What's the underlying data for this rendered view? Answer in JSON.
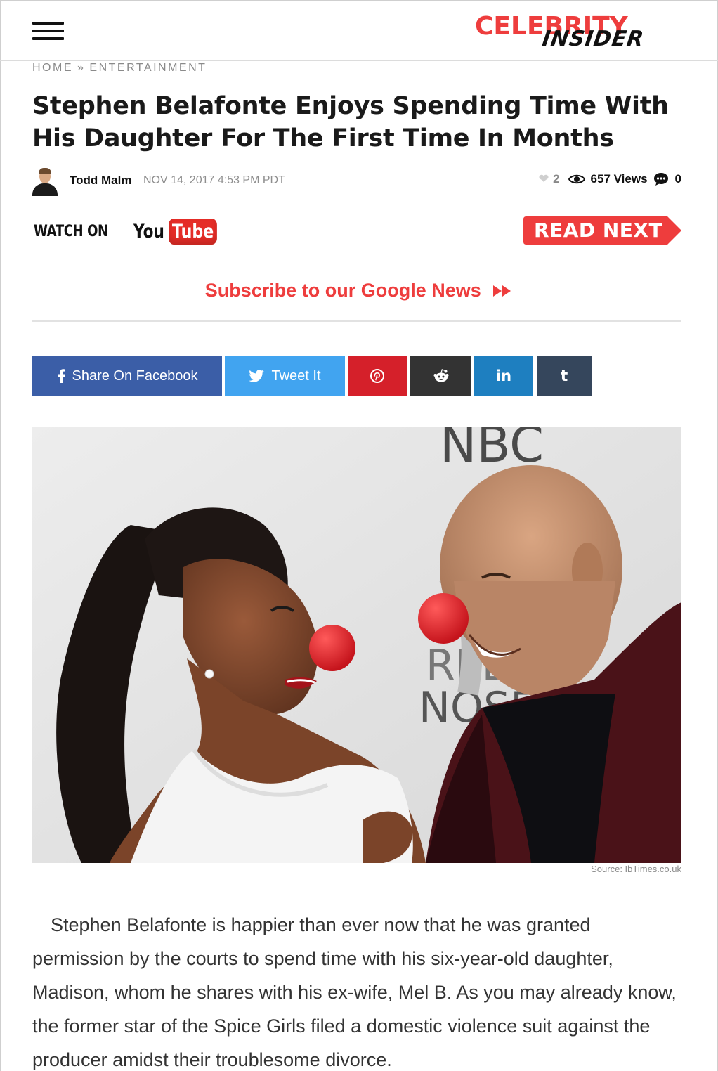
{
  "site": {
    "logo_top": "CELEBRITY",
    "logo_bottom": "INSIDER",
    "accent_color": "#ee3d3d"
  },
  "breadcrumb": {
    "home": "HOME",
    "separator": "»",
    "section": "ENTERTAINMENT"
  },
  "article": {
    "title": "Stephen Belafonte Enjoys Spending Time With His Daughter For The First Time In Months",
    "author": "Todd Malm",
    "date": "NOV 14, 2017 4:53 PM PDT",
    "likes": "2",
    "views": "657 Views",
    "comments": "0",
    "image_source": "Source: IbTimes.co.uk",
    "body": "Stephen Belafonte is happier than ever now that he was granted permission by the courts to spend time with his six-year-old daughter, Madison, whom he shares with his ex-wife, Mel B. As you may already know, the former star of the Spice Girls filed a domestic violence suit against the producer amidst their troublesome divorce."
  },
  "promo": {
    "watch_on": "WATCH ON",
    "you": "You",
    "tube": "Tube",
    "read_next": "READ NEXT",
    "subscribe": "Subscribe to our Google News"
  },
  "share": {
    "facebook_label": "Share On Facebook",
    "twitter_label": "Tweet It",
    "facebook_color": "#3b5ea7",
    "twitter_color": "#41a4f0",
    "pinterest_color": "#d5202a",
    "reddit_color": "#333333",
    "linkedin_color": "#1e7fc0",
    "tumblr_color": "#35465c",
    "linkedin_glyph": "in",
    "tumblr_glyph": "t"
  },
  "icons": {
    "menu": "hamburger-icon",
    "heart": "heart-icon",
    "eye": "eye-icon",
    "comment": "comment-icon",
    "subscribe_arrow": "fast-forward-icon"
  }
}
